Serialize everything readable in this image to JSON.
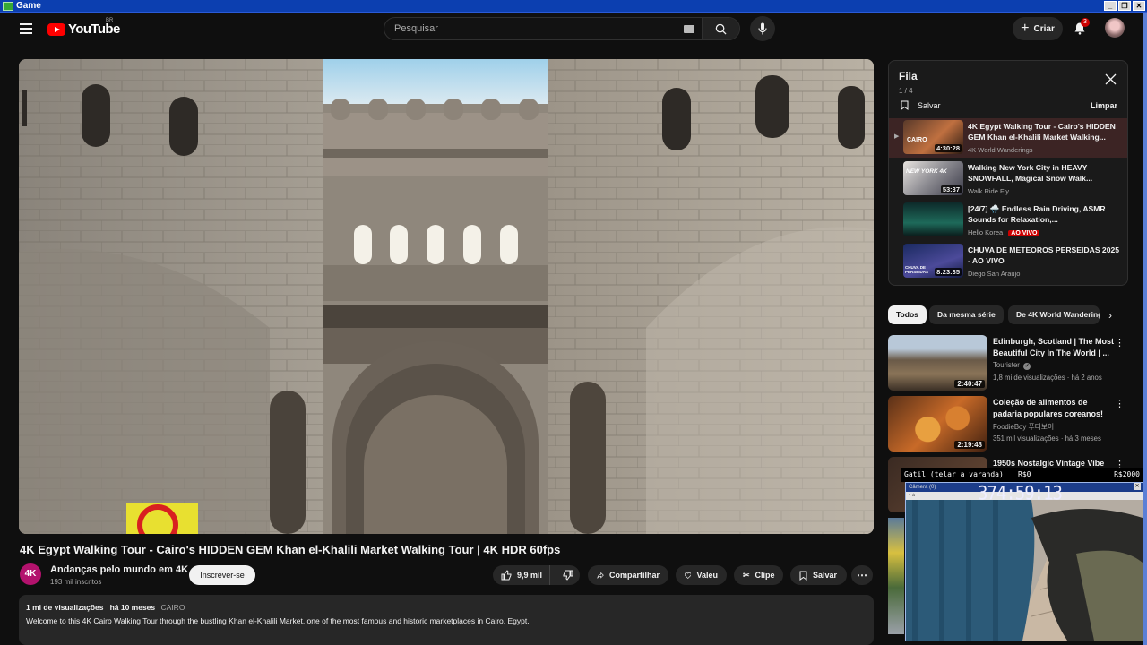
{
  "window": {
    "title": "Game"
  },
  "header": {
    "logo_text": "YouTube",
    "region": "BR",
    "search_placeholder": "Pesquisar",
    "create_label": "Criar",
    "notification_count": "3"
  },
  "video": {
    "title": "4K Egypt Walking Tour - Cairo's HIDDEN GEM Khan el-Khalili Market Walking Tour | 4K HDR 60fps",
    "channel": {
      "avatar_text": "4K",
      "name": "Andanças pelo mundo em 4K",
      "subscribers": "193 mil inscritos",
      "subscribe_label": "Inscrever-se"
    },
    "actions": {
      "likes": "9,9 mil",
      "share": "Compartilhar",
      "thanks": "Valeu",
      "clip": "Clipe",
      "save": "Salvar",
      "more": "⋯"
    },
    "description": {
      "views": "1 mi de visualizações",
      "age": "há 10 meses",
      "tag": "CAIRO",
      "text": "Welcome to this 4K Cairo Walking Tour through the bustling Khan el-Khalili Market, one of the most famous and historic marketplaces in Cairo, Egypt."
    }
  },
  "queue": {
    "title": "Fila",
    "count": "1 / 4",
    "save_label": "Salvar",
    "clear_label": "Limpar",
    "items": [
      {
        "title": "4K Egypt Walking Tour - Cairo's HIDDEN GEM Khan el-Khalili Market Walking...",
        "channel": "4K World Wanderings",
        "duration": "4:30:28",
        "thumb_text": "CAIRO",
        "active": true
      },
      {
        "title": "Walking New York City in HEAVY SNOWFALL, Magical Snow Walk...",
        "channel": "Walk Ride Fly",
        "duration": "53:37",
        "thumb_text": "NEW YORK 4K",
        "active": false
      },
      {
        "title": "[24/7] 🌧️ Endless Rain Driving, ASMR Sounds for Relaxation,...",
        "channel": "Hello Korea",
        "duration": "",
        "live": "AO VIVO",
        "active": false
      },
      {
        "title": "CHUVA DE METEOROS PERSEIDAS 2025 - AO VIVO",
        "channel": "Diego San Araujo",
        "duration": "8:23:35",
        "thumb_text": "CHUVA DE PERSEIDAS",
        "active": false
      }
    ]
  },
  "chips": [
    "Todos",
    "Da mesma série",
    "De 4K World Wanderings"
  ],
  "recommendations": [
    {
      "title": "Edinburgh, Scotland | The Most Beautiful City In The World | ...",
      "channel": "Tourister",
      "verified": "✔",
      "stats": "1,8 mi de visualizações · há 2 anos",
      "duration": "2:40:47"
    },
    {
      "title": "Coleção de alimentos de padaria populares coreanos!",
      "channel": "FoodieBoy 푸디보이",
      "stats": "351 mil visualizações · há 3 meses",
      "duration": "2:19:48"
    },
    {
      "title": "1950s Nostalgic Vintage Vibe",
      "channel": "",
      "stats": "",
      "duration": ""
    }
  ],
  "overlay": {
    "item": "Gatil (telar a varanda)",
    "amount": "R$0",
    "goal": "R$2000",
    "cam_title": "Câmera (0)",
    "timer": "374:59:13"
  },
  "colors": {
    "accent": "#ff0000",
    "live": "#cc0000",
    "background": "#0f0f0f",
    "surface": "#272727"
  }
}
